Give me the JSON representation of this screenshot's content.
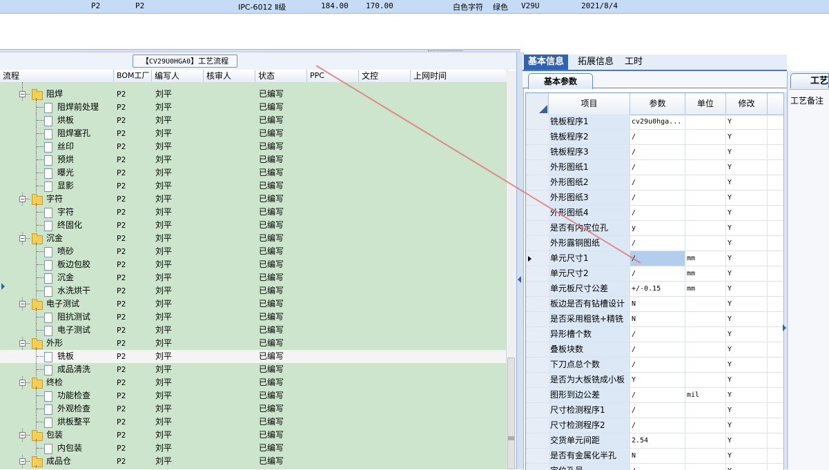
{
  "top_row": {
    "c1": "P2",
    "c2": "P2",
    "c3": "IPC-6012 Ⅱ级",
    "c4": "184.00",
    "c5": "170.00",
    "c6": "白色字符",
    "c7": "绿色",
    "c8": "V29U",
    "c9": "2021/8/4"
  },
  "left_panel": {
    "title_code": "CV29U0HGA0",
    "title_prefix": "【",
    "title_suffix": "】工艺流程",
    "columns": [
      "流程",
      "BOM工厂",
      "编写人",
      "核审人",
      "状态",
      "PPC",
      "文控",
      "上网时间"
    ]
  },
  "tree_rows": [
    {
      "label": "阻焊",
      "level": 1,
      "bom": "P2",
      "writer": "刘平",
      "status": "已编写"
    },
    {
      "label": "阻焊前处理",
      "level": 2,
      "bom": "P2",
      "writer": "刘平",
      "status": "已编写"
    },
    {
      "label": "烘板",
      "level": 2,
      "bom": "P2",
      "writer": "刘平",
      "status": "已编写"
    },
    {
      "label": "阻焊塞孔",
      "level": 2,
      "bom": "P2",
      "writer": "刘平",
      "status": "已编写"
    },
    {
      "label": "丝印",
      "level": 2,
      "bom": "P2",
      "writer": "刘平",
      "status": "已编写"
    },
    {
      "label": "预烘",
      "level": 2,
      "bom": "P2",
      "writer": "刘平",
      "status": "已编写"
    },
    {
      "label": "曝光",
      "level": 2,
      "bom": "P2",
      "writer": "刘平",
      "status": "已编写"
    },
    {
      "label": "显影",
      "level": 2,
      "bom": "P2",
      "writer": "刘平",
      "status": "已编写"
    },
    {
      "label": "字符",
      "level": 1,
      "bom": "P2",
      "writer": "刘平",
      "status": "已编写"
    },
    {
      "label": "字符",
      "level": 2,
      "bom": "P2",
      "writer": "刘平",
      "status": "已编写"
    },
    {
      "label": "终固化",
      "level": 2,
      "bom": "P2",
      "writer": "刘平",
      "status": "已编写"
    },
    {
      "label": "沉金",
      "level": 1,
      "bom": "P2",
      "writer": "刘平",
      "status": "已编写"
    },
    {
      "label": "喷砂",
      "level": 2,
      "bom": "P2",
      "writer": "刘平",
      "status": "已编写"
    },
    {
      "label": "板边包胶",
      "level": 2,
      "bom": "P2",
      "writer": "刘平",
      "status": "已编写"
    },
    {
      "label": "沉金",
      "level": 2,
      "bom": "P2",
      "writer": "刘平",
      "status": "已编写"
    },
    {
      "label": "水洗烘干",
      "level": 2,
      "bom": "P2",
      "writer": "刘平",
      "status": "已编写"
    },
    {
      "label": "电子测试",
      "level": 1,
      "bom": "P2",
      "writer": "刘平",
      "status": "已编写"
    },
    {
      "label": "阻抗测试",
      "level": 2,
      "bom": "P2",
      "writer": "刘平",
      "status": "已编写"
    },
    {
      "label": "电子测试",
      "level": 2,
      "bom": "P2",
      "writer": "刘平",
      "status": "已编写"
    },
    {
      "label": "外形",
      "level": 1,
      "bom": "P2",
      "writer": "刘平",
      "status": "已编写"
    },
    {
      "label": "铣板",
      "level": 2,
      "bom": "P2",
      "writer": "刘平",
      "status": "已编写",
      "selected": true
    },
    {
      "label": "成品清洗",
      "level": 2,
      "bom": "P2",
      "writer": "刘平",
      "status": "已编写"
    },
    {
      "label": "终检",
      "level": 1,
      "bom": "P2",
      "writer": "刘平",
      "status": "已编写"
    },
    {
      "label": "功能检查",
      "level": 2,
      "bom": "P2",
      "writer": "刘平",
      "status": "已编写"
    },
    {
      "label": "外观检查",
      "level": 2,
      "bom": "P2",
      "writer": "刘平",
      "status": "已编写"
    },
    {
      "label": "烘板整平",
      "level": 2,
      "bom": "P2",
      "writer": "刘平",
      "status": "已编写"
    },
    {
      "label": "包装",
      "level": 1,
      "bom": "P2",
      "writer": "刘平",
      "status": "已编写"
    },
    {
      "label": "内包装",
      "level": 2,
      "bom": "P2",
      "writer": "刘平",
      "status": "已编写"
    },
    {
      "label": "成品仓",
      "level": 1,
      "bom": "P2",
      "writer": "刘平",
      "status": "已编写"
    }
  ],
  "right_panel": {
    "tabs": [
      "基本信息",
      "拓展信息",
      "工时"
    ],
    "sub_tab": "基本参数",
    "columns": [
      "项目",
      "参数",
      "单位",
      "修改"
    ],
    "far_tab": "工艺",
    "far_label": "工艺备注"
  },
  "params": [
    {
      "item": "铣板程序1",
      "param": "cv29u0hga...",
      "unit": "",
      "mod": "Y"
    },
    {
      "item": "铣板程序2",
      "param": "/",
      "unit": "",
      "mod": "Y"
    },
    {
      "item": "铣板程序3",
      "param": "/",
      "unit": "",
      "mod": "Y"
    },
    {
      "item": "外形图纸1",
      "param": "/",
      "unit": "",
      "mod": "Y"
    },
    {
      "item": "外形图纸2",
      "param": "/",
      "unit": "",
      "mod": "Y"
    },
    {
      "item": "外形图纸3",
      "param": "/",
      "unit": "",
      "mod": "Y"
    },
    {
      "item": "外形图纸4",
      "param": "/",
      "unit": "",
      "mod": "Y"
    },
    {
      "item": "是否有内定位孔",
      "param": "y",
      "unit": "",
      "mod": "Y"
    },
    {
      "item": "外形露铜图纸",
      "param": "/",
      "unit": "",
      "mod": "Y"
    },
    {
      "item": "单元尺寸1",
      "param": "/",
      "unit": "mm",
      "mod": "Y",
      "current": true
    },
    {
      "item": "单元尺寸2",
      "param": "/",
      "unit": "mm",
      "mod": "Y"
    },
    {
      "item": "单元板尺寸公差",
      "param": "+/-0.15",
      "unit": "mm",
      "mod": "Y"
    },
    {
      "item": "板边是否有钻槽设计",
      "param": "N",
      "unit": "",
      "mod": "Y"
    },
    {
      "item": "是否采用粗铣+精铣",
      "param": "N",
      "unit": "",
      "mod": "Y"
    },
    {
      "item": "异形槽个数",
      "param": "/",
      "unit": "",
      "mod": "Y"
    },
    {
      "item": "叠板块数",
      "param": "/",
      "unit": "",
      "mod": "Y"
    },
    {
      "item": "下刀点总个数",
      "param": "/",
      "unit": "",
      "mod": "Y"
    },
    {
      "item": "是否为大板铣成小板",
      "param": "Y",
      "unit": "",
      "mod": "Y"
    },
    {
      "item": "图形到边公差",
      "param": "/",
      "unit": "mil",
      "mod": "Y"
    },
    {
      "item": "尺寸检测程序1",
      "param": "/",
      "unit": "",
      "mod": "Y"
    },
    {
      "item": "尺寸检测程序2",
      "param": "/",
      "unit": "",
      "mod": "Y"
    },
    {
      "item": "交货单元间距",
      "param": "2.54",
      "unit": "",
      "mod": "Y"
    },
    {
      "item": "是否有金属化半孔",
      "param": "N",
      "unit": "",
      "mod": "Y"
    },
    {
      "item": "定位孔号",
      "param": "/",
      "unit": "",
      "mod": "Y"
    }
  ],
  "colors": {
    "tree_bg": "#cde5cd",
    "accent": "#3161b3",
    "annotation": "#e06a6a"
  }
}
